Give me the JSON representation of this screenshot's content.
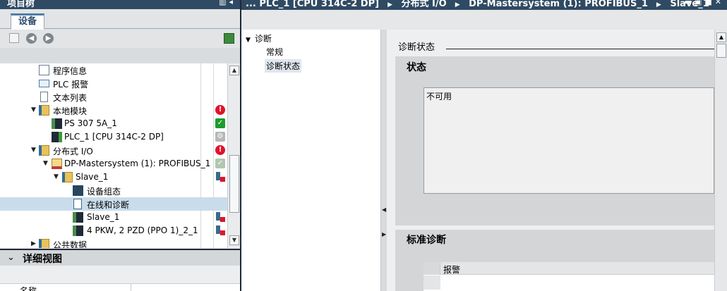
{
  "left_panel": {
    "title": "项目树",
    "tab_devices": "设备",
    "tree": [
      {
        "label": "程序信息",
        "icon": "program-info-icon",
        "status": ""
      },
      {
        "label": "PLC 报警",
        "icon": "mail-icon",
        "status": ""
      },
      {
        "label": "文本列表",
        "icon": "document-icon",
        "status": ""
      },
      {
        "label": "本地模块",
        "icon": "folder-icon",
        "status": "error"
      },
      {
        "label": "PS 307 5A_1",
        "icon": "module-icon",
        "status": "ok"
      },
      {
        "label": "PLC_1 [CPU 314C-2 DP]",
        "icon": "plc-icon",
        "status": "config"
      },
      {
        "label": "分布式 I/O",
        "icon": "folder-icon",
        "status": "error"
      },
      {
        "label": "DP-Mastersystem (1): PROFIBUS_1",
        "icon": "network-icon",
        "status": "config-ok"
      },
      {
        "label": "Slave_1",
        "icon": "folder-icon",
        "status": "device-error"
      },
      {
        "label": "设备组态",
        "icon": "device-config-icon",
        "status": ""
      },
      {
        "label": "在线和诊断",
        "icon": "online-diagnostics-icon",
        "status": ""
      },
      {
        "label": "Slave_1",
        "icon": "module-icon",
        "status": "device-error"
      },
      {
        "label": "4 PKW, 2 PZD  (PPO 1)_2_1",
        "icon": "module-icon",
        "status": "device-error"
      },
      {
        "label": "公共数据",
        "icon": "folder-icon",
        "status": ""
      }
    ],
    "detail_view_title": "详细视图",
    "detail_column_name": "名称"
  },
  "breadcrumb": [
    "... PLC_1 [CPU 314C-2 DP]",
    "分布式 I/O",
    "DP-Mastersystem (1): PROFIBUS_1",
    "Slave_1"
  ],
  "nav": {
    "diagnostics": "诊断",
    "general": "常规",
    "diagnostic_status": "诊断状态"
  },
  "content": {
    "section_title": "诊断状态",
    "status_heading": "状态",
    "status_value": "不可用",
    "standard_diag_heading": "标准诊断",
    "alarm_column": "报警"
  },
  "colors": {
    "title_bar": "#2f4a63",
    "selection": "#c9dceb",
    "error": "#e0142a",
    "ok": "#1a9c2e"
  }
}
